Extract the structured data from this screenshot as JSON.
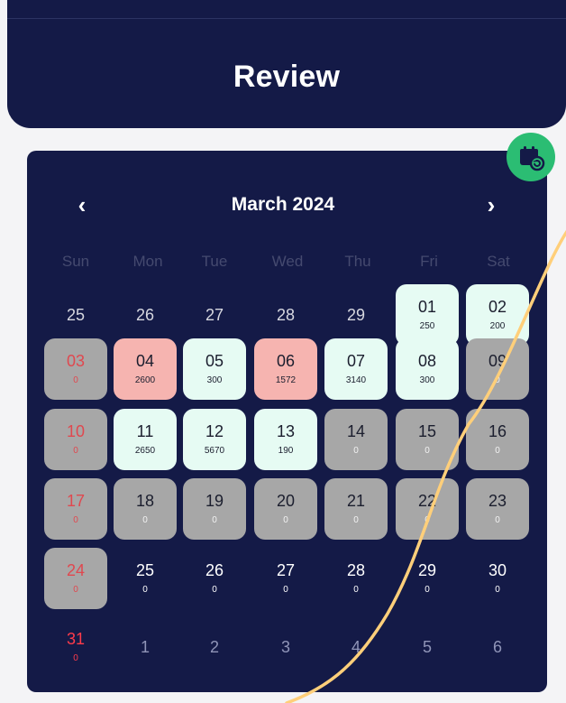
{
  "header": {
    "title": "Review"
  },
  "calendar": {
    "month_label": "March 2024",
    "prev_icon": "chevron-left-icon",
    "next_icon": "chevron-right-icon",
    "fab_icon": "calendar-refresh-icon",
    "prev_symbol": "‹",
    "next_symbol": "›",
    "weekdays": [
      "Sun",
      "Mon",
      "Tue",
      "Wed",
      "Thu",
      "Fri",
      "Sat"
    ],
    "colors": {
      "navy": "#141a47",
      "green_cell": "#e6fbf3",
      "pink_cell": "#f6b4b0",
      "gray_cell": "#a7a7a7",
      "sunday_red": "#e0484f",
      "fab_green": "#2bbd73"
    },
    "weeks": [
      [
        {
          "day": "25",
          "count": "",
          "status": "outside"
        },
        {
          "day": "26",
          "count": "",
          "status": "outside"
        },
        {
          "day": "27",
          "count": "",
          "status": "outside"
        },
        {
          "day": "28",
          "count": "",
          "status": "outside"
        },
        {
          "day": "29",
          "count": "",
          "status": "outside"
        },
        {
          "day": "01",
          "count": "250",
          "status": "green"
        },
        {
          "day": "02",
          "count": "200",
          "status": "green"
        }
      ],
      [
        {
          "day": "03",
          "count": "0",
          "status": "gray-sunday"
        },
        {
          "day": "04",
          "count": "2600",
          "status": "pink"
        },
        {
          "day": "05",
          "count": "300",
          "status": "green"
        },
        {
          "day": "06",
          "count": "1572",
          "status": "pink"
        },
        {
          "day": "07",
          "count": "3140",
          "status": "green"
        },
        {
          "day": "08",
          "count": "300",
          "status": "green"
        },
        {
          "day": "09",
          "count": "0",
          "status": "gray"
        }
      ],
      [
        {
          "day": "10",
          "count": "0",
          "status": "gray-sunday"
        },
        {
          "day": "11",
          "count": "2650",
          "status": "green"
        },
        {
          "day": "12",
          "count": "5670",
          "status": "green"
        },
        {
          "day": "13",
          "count": "190",
          "status": "green"
        },
        {
          "day": "14",
          "count": "0",
          "status": "gray"
        },
        {
          "day": "15",
          "count": "0",
          "status": "gray"
        },
        {
          "day": "16",
          "count": "0",
          "status": "gray"
        }
      ],
      [
        {
          "day": "17",
          "count": "0",
          "status": "gray-sunday"
        },
        {
          "day": "18",
          "count": "0",
          "status": "gray"
        },
        {
          "day": "19",
          "count": "0",
          "status": "gray"
        },
        {
          "day": "20",
          "count": "0",
          "status": "gray"
        },
        {
          "day": "21",
          "count": "0",
          "status": "gray"
        },
        {
          "day": "22",
          "count": "0",
          "status": "gray"
        },
        {
          "day": "23",
          "count": "0",
          "status": "gray"
        }
      ],
      [
        {
          "day": "24",
          "count": "0",
          "status": "gray-sunday"
        },
        {
          "day": "25",
          "count": "0",
          "status": "plain"
        },
        {
          "day": "26",
          "count": "0",
          "status": "plain"
        },
        {
          "day": "27",
          "count": "0",
          "status": "plain"
        },
        {
          "day": "28",
          "count": "0",
          "status": "plain"
        },
        {
          "day": "29",
          "count": "0",
          "status": "plain"
        },
        {
          "day": "30",
          "count": "0",
          "status": "plain"
        }
      ],
      [
        {
          "day": "31",
          "count": "0",
          "status": "plain-sunday"
        },
        {
          "day": "1",
          "count": "",
          "status": "next-month"
        },
        {
          "day": "2",
          "count": "",
          "status": "next-month"
        },
        {
          "day": "3",
          "count": "",
          "status": "next-month"
        },
        {
          "day": "4",
          "count": "",
          "status": "next-month"
        },
        {
          "day": "5",
          "count": "",
          "status": "next-month"
        },
        {
          "day": "6",
          "count": "",
          "status": "next-month"
        }
      ]
    ]
  }
}
